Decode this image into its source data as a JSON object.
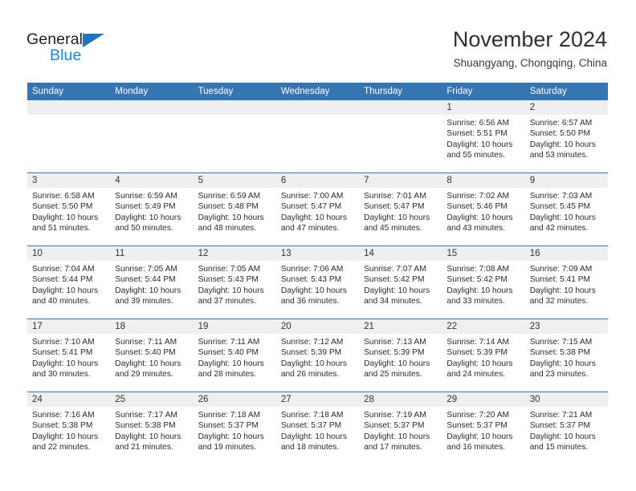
{
  "brand": {
    "name_part1": "General",
    "name_part2": "Blue",
    "triangle_color": "#1f74bb",
    "blue_text_color": "#1f83d4",
    "dark_text_color": "#231f20"
  },
  "header": {
    "title": "November 2024",
    "subtitle": "Shuangyang, Chongqing, China"
  },
  "theme": {
    "header_blue": "#3575b2",
    "daynum_band_gray": "#efefef",
    "row_divider": "#3575b2",
    "page_background": "#ffffff"
  },
  "weekdays": [
    "Sunday",
    "Monday",
    "Tuesday",
    "Wednesday",
    "Thursday",
    "Friday",
    "Saturday"
  ],
  "labels": {
    "sunrise_prefix": "Sunrise:",
    "sunset_prefix": "Sunset:",
    "daylight_prefix": "Daylight:"
  },
  "weeks": [
    [
      {
        "day": "",
        "empty": true
      },
      {
        "day": "",
        "empty": true
      },
      {
        "day": "",
        "empty": true
      },
      {
        "day": "",
        "empty": true
      },
      {
        "day": "",
        "empty": true
      },
      {
        "day": "1",
        "sunrise": "Sunrise: 6:56 AM",
        "sunset": "Sunset: 5:51 PM",
        "daylight_line1": "Daylight: 10 hours",
        "daylight_line2": "and 55 minutes."
      },
      {
        "day": "2",
        "sunrise": "Sunrise: 6:57 AM",
        "sunset": "Sunset: 5:50 PM",
        "daylight_line1": "Daylight: 10 hours",
        "daylight_line2": "and 53 minutes."
      }
    ],
    [
      {
        "day": "3",
        "sunrise": "Sunrise: 6:58 AM",
        "sunset": "Sunset: 5:50 PM",
        "daylight_line1": "Daylight: 10 hours",
        "daylight_line2": "and 51 minutes."
      },
      {
        "day": "4",
        "sunrise": "Sunrise: 6:59 AM",
        "sunset": "Sunset: 5:49 PM",
        "daylight_line1": "Daylight: 10 hours",
        "daylight_line2": "and 50 minutes."
      },
      {
        "day": "5",
        "sunrise": "Sunrise: 6:59 AM",
        "sunset": "Sunset: 5:48 PM",
        "daylight_line1": "Daylight: 10 hours",
        "daylight_line2": "and 48 minutes."
      },
      {
        "day": "6",
        "sunrise": "Sunrise: 7:00 AM",
        "sunset": "Sunset: 5:47 PM",
        "daylight_line1": "Daylight: 10 hours",
        "daylight_line2": "and 47 minutes."
      },
      {
        "day": "7",
        "sunrise": "Sunrise: 7:01 AM",
        "sunset": "Sunset: 5:47 PM",
        "daylight_line1": "Daylight: 10 hours",
        "daylight_line2": "and 45 minutes."
      },
      {
        "day": "8",
        "sunrise": "Sunrise: 7:02 AM",
        "sunset": "Sunset: 5:46 PM",
        "daylight_line1": "Daylight: 10 hours",
        "daylight_line2": "and 43 minutes."
      },
      {
        "day": "9",
        "sunrise": "Sunrise: 7:03 AM",
        "sunset": "Sunset: 5:45 PM",
        "daylight_line1": "Daylight: 10 hours",
        "daylight_line2": "and 42 minutes."
      }
    ],
    [
      {
        "day": "10",
        "sunrise": "Sunrise: 7:04 AM",
        "sunset": "Sunset: 5:44 PM",
        "daylight_line1": "Daylight: 10 hours",
        "daylight_line2": "and 40 minutes."
      },
      {
        "day": "11",
        "sunrise": "Sunrise: 7:05 AM",
        "sunset": "Sunset: 5:44 PM",
        "daylight_line1": "Daylight: 10 hours",
        "daylight_line2": "and 39 minutes."
      },
      {
        "day": "12",
        "sunrise": "Sunrise: 7:05 AM",
        "sunset": "Sunset: 5:43 PM",
        "daylight_line1": "Daylight: 10 hours",
        "daylight_line2": "and 37 minutes."
      },
      {
        "day": "13",
        "sunrise": "Sunrise: 7:06 AM",
        "sunset": "Sunset: 5:43 PM",
        "daylight_line1": "Daylight: 10 hours",
        "daylight_line2": "and 36 minutes."
      },
      {
        "day": "14",
        "sunrise": "Sunrise: 7:07 AM",
        "sunset": "Sunset: 5:42 PM",
        "daylight_line1": "Daylight: 10 hours",
        "daylight_line2": "and 34 minutes."
      },
      {
        "day": "15",
        "sunrise": "Sunrise: 7:08 AM",
        "sunset": "Sunset: 5:42 PM",
        "daylight_line1": "Daylight: 10 hours",
        "daylight_line2": "and 33 minutes."
      },
      {
        "day": "16",
        "sunrise": "Sunrise: 7:09 AM",
        "sunset": "Sunset: 5:41 PM",
        "daylight_line1": "Daylight: 10 hours",
        "daylight_line2": "and 32 minutes."
      }
    ],
    [
      {
        "day": "17",
        "sunrise": "Sunrise: 7:10 AM",
        "sunset": "Sunset: 5:41 PM",
        "daylight_line1": "Daylight: 10 hours",
        "daylight_line2": "and 30 minutes."
      },
      {
        "day": "18",
        "sunrise": "Sunrise: 7:11 AM",
        "sunset": "Sunset: 5:40 PM",
        "daylight_line1": "Daylight: 10 hours",
        "daylight_line2": "and 29 minutes."
      },
      {
        "day": "19",
        "sunrise": "Sunrise: 7:11 AM",
        "sunset": "Sunset: 5:40 PM",
        "daylight_line1": "Daylight: 10 hours",
        "daylight_line2": "and 28 minutes."
      },
      {
        "day": "20",
        "sunrise": "Sunrise: 7:12 AM",
        "sunset": "Sunset: 5:39 PM",
        "daylight_line1": "Daylight: 10 hours",
        "daylight_line2": "and 26 minutes."
      },
      {
        "day": "21",
        "sunrise": "Sunrise: 7:13 AM",
        "sunset": "Sunset: 5:39 PM",
        "daylight_line1": "Daylight: 10 hours",
        "daylight_line2": "and 25 minutes."
      },
      {
        "day": "22",
        "sunrise": "Sunrise: 7:14 AM",
        "sunset": "Sunset: 5:39 PM",
        "daylight_line1": "Daylight: 10 hours",
        "daylight_line2": "and 24 minutes."
      },
      {
        "day": "23",
        "sunrise": "Sunrise: 7:15 AM",
        "sunset": "Sunset: 5:38 PM",
        "daylight_line1": "Daylight: 10 hours",
        "daylight_line2": "and 23 minutes."
      }
    ],
    [
      {
        "day": "24",
        "sunrise": "Sunrise: 7:16 AM",
        "sunset": "Sunset: 5:38 PM",
        "daylight_line1": "Daylight: 10 hours",
        "daylight_line2": "and 22 minutes."
      },
      {
        "day": "25",
        "sunrise": "Sunrise: 7:17 AM",
        "sunset": "Sunset: 5:38 PM",
        "daylight_line1": "Daylight: 10 hours",
        "daylight_line2": "and 21 minutes."
      },
      {
        "day": "26",
        "sunrise": "Sunrise: 7:18 AM",
        "sunset": "Sunset: 5:37 PM",
        "daylight_line1": "Daylight: 10 hours",
        "daylight_line2": "and 19 minutes."
      },
      {
        "day": "27",
        "sunrise": "Sunrise: 7:18 AM",
        "sunset": "Sunset: 5:37 PM",
        "daylight_line1": "Daylight: 10 hours",
        "daylight_line2": "and 18 minutes."
      },
      {
        "day": "28",
        "sunrise": "Sunrise: 7:19 AM",
        "sunset": "Sunset: 5:37 PM",
        "daylight_line1": "Daylight: 10 hours",
        "daylight_line2": "and 17 minutes."
      },
      {
        "day": "29",
        "sunrise": "Sunrise: 7:20 AM",
        "sunset": "Sunset: 5:37 PM",
        "daylight_line1": "Daylight: 10 hours",
        "daylight_line2": "and 16 minutes."
      },
      {
        "day": "30",
        "sunrise": "Sunrise: 7:21 AM",
        "sunset": "Sunset: 5:37 PM",
        "daylight_line1": "Daylight: 10 hours",
        "daylight_line2": "and 15 minutes."
      }
    ]
  ]
}
